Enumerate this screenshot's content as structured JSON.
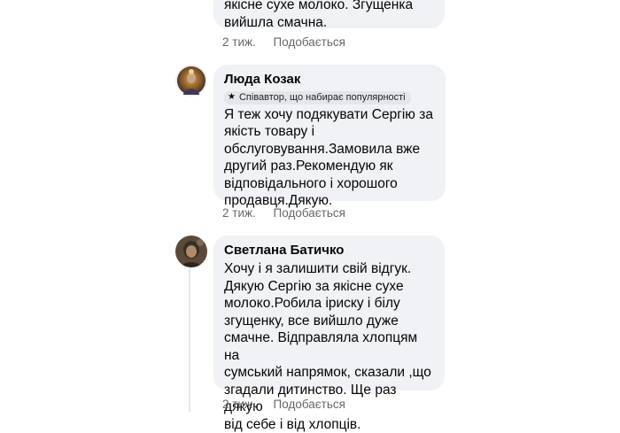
{
  "comments": [
    {
      "author": "",
      "text_lines": [
        "якісне сухе молоко. Згущенка",
        "вийшла смачна."
      ],
      "time": "2 тиж.",
      "like_label": "Подобається"
    },
    {
      "author": "Люда Козак",
      "badge": "Співавтор, що набирає популярності",
      "badge_icon": "star-icon",
      "text_lines": [
        "Я теж хочу подякувати Сергію за",
        "якість товару і",
        "обслуговування.Замовила вже",
        "другий раз.Рекомендую як",
        "відповідального і хорошого",
        "продавця.Дякую."
      ],
      "time": "2 тиж.",
      "like_label": "Подобається"
    },
    {
      "author": "Светлана Батичко",
      "text_lines": [
        "Хочу і я залишити свій відгук.",
        "Дякую Сергію за якісне сухе",
        "молоко.Робила іриску і білу",
        "згущенку, все вийшло дуже",
        "смачне. Відправляла хлопцям на",
        "сумський напрямок, сказали ,що",
        "згадали дитинство. Ще раз дякую",
        "від себе і від хлопців."
      ],
      "time": "2 тиж.",
      "like_label": "Подобається"
    }
  ]
}
